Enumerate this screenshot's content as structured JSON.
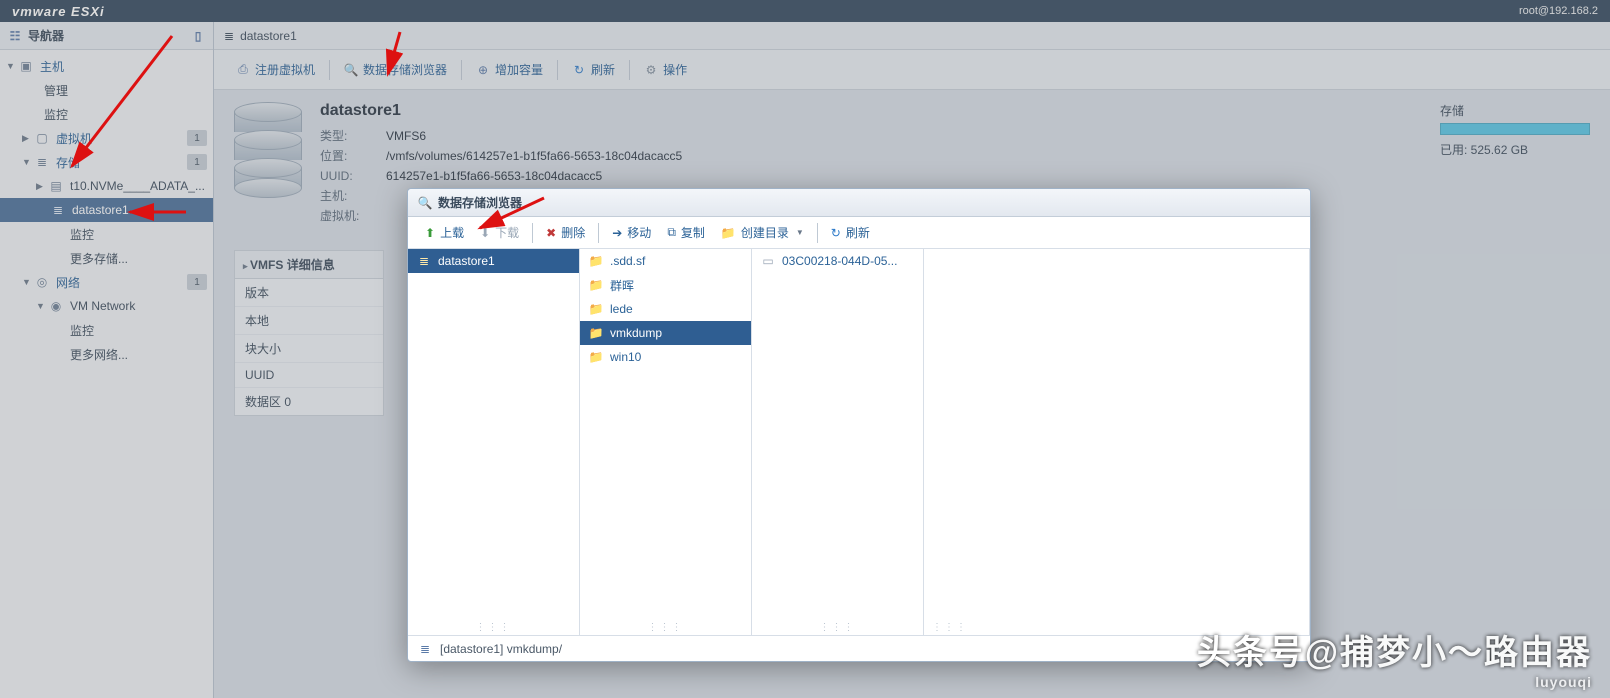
{
  "brand": "vmware ESXi",
  "user": "root@192.168.2",
  "nav": {
    "title": "导航器",
    "host": "主机",
    "host_children": [
      "管理",
      "监控"
    ],
    "vm": {
      "label": "虚拟机",
      "count": "1"
    },
    "storage": {
      "label": "存储",
      "count": "1"
    },
    "storage_children": [
      "t10.NVMe____ADATA_...",
      "datastore1"
    ],
    "storage_sub": [
      "监控",
      "更多存储..."
    ],
    "network": {
      "label": "网络",
      "count": "1"
    },
    "network_children": [
      "VM Network"
    ],
    "network_sub": [
      "监控",
      "更多网络..."
    ]
  },
  "crumb": "datastore1",
  "toolbar": {
    "register": "注册虚拟机",
    "browser": "数据存储浏览器",
    "expand": "增加容量",
    "refresh": "刷新",
    "actions": "操作"
  },
  "ds": {
    "name": "datastore1",
    "rows": {
      "type_l": "类型:",
      "type_v": "VMFS6",
      "loc_l": "位置:",
      "loc_v": "/vmfs/volumes/614257e1-b1f5fa66-5653-18c04dacacc5",
      "uuid_l": "UUID:",
      "uuid_v": "614257e1-b1f5fa66-5653-18c04dacacc5",
      "hosts_l": "主机:",
      "vms_l": "虚拟机:"
    }
  },
  "storage_box": {
    "title": "存储",
    "used": "已用: 525.62 GB"
  },
  "vmfs": {
    "title": "VMFS 详细信息",
    "rows": [
      "版本",
      "本地",
      "块大小",
      "UUID",
      "数据区 0"
    ]
  },
  "modal": {
    "title": "数据存储浏览器",
    "tb": {
      "upload": "上载",
      "download": "下载",
      "delete": "删除",
      "move": "移动",
      "copy": "复制",
      "mkdir": "创建目录",
      "refresh": "刷新"
    },
    "col1": [
      "datastore1"
    ],
    "col2": [
      {
        "name": ".sdd.sf",
        "type": "folder"
      },
      {
        "name": "群晖",
        "type": "folder"
      },
      {
        "name": "lede",
        "type": "folder"
      },
      {
        "name": "vmkdump",
        "type": "folder",
        "selected": true
      },
      {
        "name": "win10",
        "type": "folder"
      }
    ],
    "col3": [
      {
        "name": "03C00218-044D-05...",
        "type": "file"
      }
    ],
    "status": "[datastore1] vmkdump/"
  },
  "watermark": "头条号@捕梦小～路由器",
  "watermark_sub": "luyouqi"
}
